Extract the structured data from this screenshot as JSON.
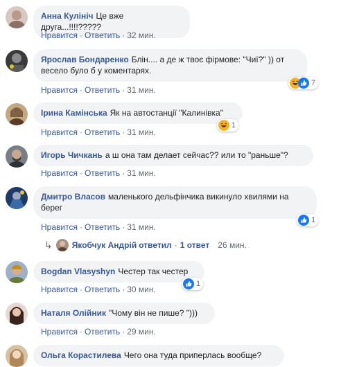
{
  "actions": {
    "like": "Нравится",
    "reply": "Ответить",
    "sep": "·"
  },
  "comments": [
    {
      "author": "Анна Кулініч",
      "text": "Це вже друга...!!!!?????",
      "time": "32 мин.",
      "reactions": null,
      "avatar_color": "#c9b4a8"
    },
    {
      "author": "Ярослав Бондаренко",
      "text": "Блін.... а де ж твоє фірмове: \"Чиї?\" )) от весело було б у коментарях.",
      "time": "31 мин.",
      "reactions": {
        "count": "7",
        "icons": [
          "haha-icon",
          "like-icon"
        ]
      },
      "avatar_color": "#4a4a4a"
    },
    {
      "author": "Ірина Камінська",
      "text": "Як на автостанції \"Калинівка\"",
      "time": "31 мин.",
      "reactions": {
        "count": "1",
        "icons": [
          "haha-icon"
        ]
      },
      "avatar_color": "#8a6b4e"
    },
    {
      "author": "Игорь Чичкань",
      "text": "а ш она там делает сейчас?? или то \"раньше\"?",
      "time": "31 мин.",
      "reactions": null,
      "avatar_color": "#5a5f66"
    },
    {
      "author": "Дмитро Власов",
      "text": "маленького дельфінчика викинуло хвилями на берег",
      "time": "31 мин.",
      "reactions": {
        "count": "1",
        "icons": [
          "like-icon"
        ]
      },
      "avatar_color": "#2d4d7a"
    },
    {
      "author": "Bogdan Vlasyshyn",
      "text": "Честер так честер",
      "time": "30 мин.",
      "reactions": {
        "count": "1",
        "icons": [
          "like-icon"
        ]
      },
      "avatar_color": "#7d8c4a"
    },
    {
      "author": "Наталя Олійник",
      "text": "\"Чому він не пише? \")))",
      "time": "29 мин.",
      "reactions": null,
      "avatar_color": "#6b4a3e"
    },
    {
      "author": "Ольга Корастилева",
      "text": "Чего она туда приперлась вообще?",
      "time": "",
      "reactions": null,
      "avatar_color": "#9a7b5c"
    }
  ],
  "reply": {
    "author": "Якобчук Андрій",
    "verb": "ответил",
    "count": "1 ответ",
    "time": "26 мин."
  },
  "colors": {
    "link": "#385898",
    "bubble": "#f2f3f5",
    "meta": "#606770",
    "like": "#1877f2",
    "haha": "#f7b125"
  }
}
